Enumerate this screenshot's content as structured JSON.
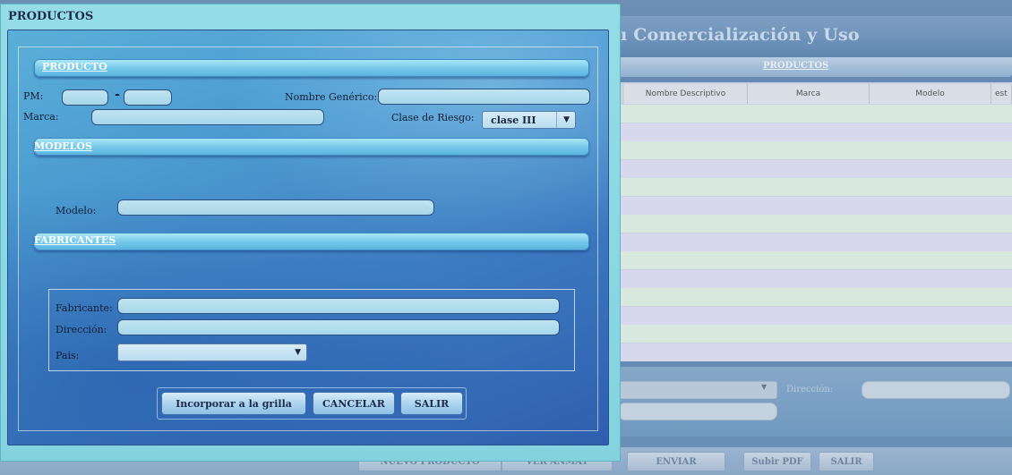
{
  "background": {
    "title": "Comercialización y Uso",
    "title_prefix": "ı",
    "products_bar": "PRODUCTOS",
    "grid_columns": [
      "Nombre Descriptivo",
      "Marca",
      "Modelo",
      "est"
    ],
    "direccion_label": "Dirección:",
    "footer_buttons": [
      "NUEVO PRODUCTO",
      "VER ANMAT",
      "ENVIAR",
      "Subir PDF",
      "SALIR"
    ]
  },
  "dialog": {
    "title": "PRODUCTOS",
    "producto": {
      "section": "PRODUCTO",
      "pm_label": "PM:",
      "pm_separator": "-",
      "pm_part1": "",
      "pm_part2": "",
      "nombre_generico_label": "Nombre Genérico:",
      "nombre_generico": "",
      "marca_label": "Marca:",
      "marca": "",
      "clase_riesgo_label": "Clase de Riesgo:",
      "clase_riesgo_value": "clase III"
    },
    "modelos": {
      "section": "MODELOS",
      "modelo_label": "Modelo:",
      "modelo": ""
    },
    "fabricantes": {
      "section": "FABRICANTES",
      "fabricante_label": "Fabricante:",
      "fabricante": "",
      "direccion_label": "Dirección:",
      "direccion": "",
      "pais_label": "Pais:",
      "pais_value": ""
    },
    "buttons": {
      "incorporar": "Incorporar a la grilla",
      "cancelar": "CANCELAR",
      "salir": "SALIR"
    }
  },
  "colors": {
    "dialog_frame": "#83d3df",
    "dialog_body": "#3b78bf",
    "section_bar": "#74c8ea",
    "title_text": "#1c2b4a"
  }
}
